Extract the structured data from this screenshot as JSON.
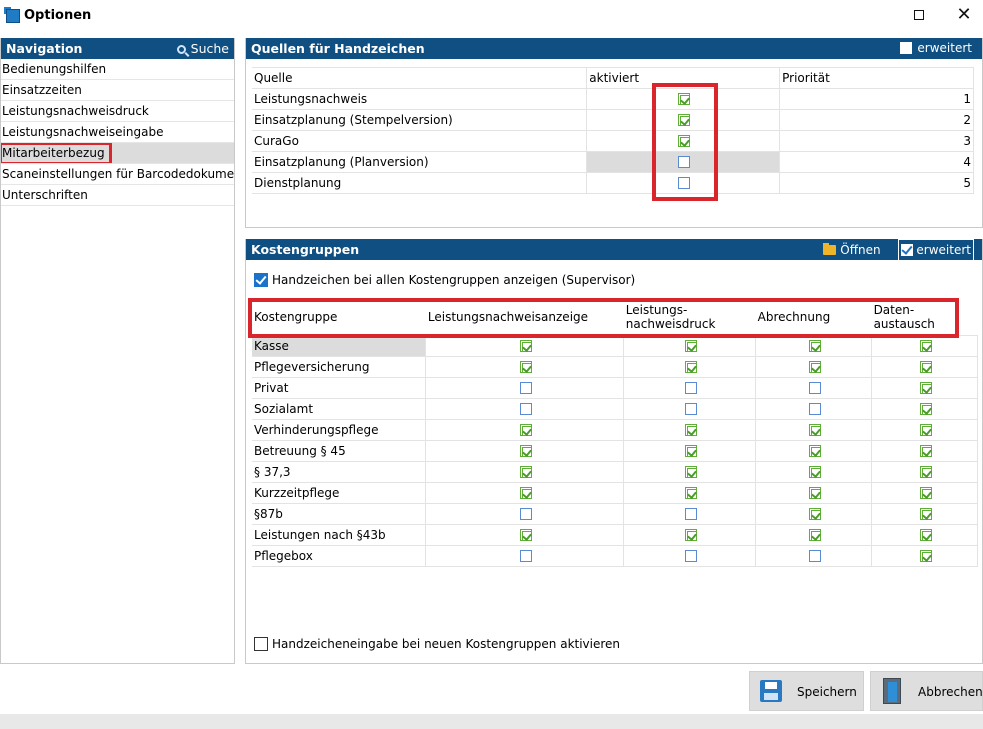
{
  "window": {
    "title": "Optionen"
  },
  "navigation": {
    "header": "Navigation",
    "search_label": "Suche",
    "items": [
      "Bedienungshilfen",
      "Einsatzzeiten",
      "Leistungsnachweisdruck",
      "Leistungsnachweiseingabe",
      "Mitarbeiterbezug",
      "Scaneinstellungen für Barcodedokumente",
      "Unterschriften"
    ],
    "selected_index": 4
  },
  "quellen": {
    "header": "Quellen für Handzeichen",
    "erweitert_label": "erweitert",
    "erweitert_checked": false,
    "columns": [
      "Quelle",
      "aktiviert",
      "Priorität"
    ],
    "rows": [
      {
        "name": "Leistungsnachweis",
        "active": true,
        "priority": "1"
      },
      {
        "name": "Einsatzplanung (Stempelversion)",
        "active": true,
        "priority": "2"
      },
      {
        "name": "CuraGo",
        "active": true,
        "priority": "3"
      },
      {
        "name": "Einsatzplanung (Planversion)",
        "active": false,
        "priority": "4"
      },
      {
        "name": "Dienstplanung",
        "active": false,
        "priority": "5"
      }
    ]
  },
  "kosten": {
    "header": "Kostengruppen",
    "open_label": "Öffnen",
    "erweitert_label": "erweitert",
    "erweitert_checked": true,
    "supervisor_label": "Handzeichen bei allen Kostengruppen anzeigen (Supervisor)",
    "supervisor_checked": true,
    "columns": [
      "Kostengruppe",
      "Leistungsnachweisanzeige",
      "Leistungs-\nnachweisdruck",
      "Abrechnung",
      "Daten-\naustausch"
    ],
    "rows": [
      {
        "name": "Kasse",
        "values": [
          true,
          true,
          true,
          true
        ]
      },
      {
        "name": "Pflegeversicherung",
        "values": [
          true,
          true,
          true,
          true
        ]
      },
      {
        "name": "Privat",
        "values": [
          false,
          false,
          false,
          true
        ]
      },
      {
        "name": "Sozialamt",
        "values": [
          false,
          false,
          false,
          true
        ]
      },
      {
        "name": "Verhinderungspflege",
        "values": [
          true,
          true,
          true,
          true
        ]
      },
      {
        "name": "Betreuung § 45",
        "values": [
          true,
          true,
          true,
          true
        ]
      },
      {
        "name": "§ 37,3",
        "values": [
          true,
          true,
          true,
          true
        ]
      },
      {
        "name": "Kurzzeitpflege",
        "values": [
          true,
          true,
          true,
          true
        ]
      },
      {
        "name": "§87b",
        "values": [
          false,
          false,
          true,
          true
        ]
      },
      {
        "name": "Leistungen nach §43b",
        "values": [
          true,
          true,
          true,
          true
        ]
      },
      {
        "name": "Pflegebox",
        "values": [
          false,
          false,
          false,
          true
        ]
      }
    ],
    "new_groups_label": "Handzeicheneingabe bei neuen Kostengruppen aktivieren",
    "new_groups_checked": false
  },
  "buttons": {
    "save": "Speichern",
    "cancel": "Abbrechen"
  },
  "colors": {
    "header_bg": "#0f4f82",
    "highlight_red": "#d9262c",
    "check_green": "#4b9d2a",
    "check_blue": "#1a73c9"
  }
}
